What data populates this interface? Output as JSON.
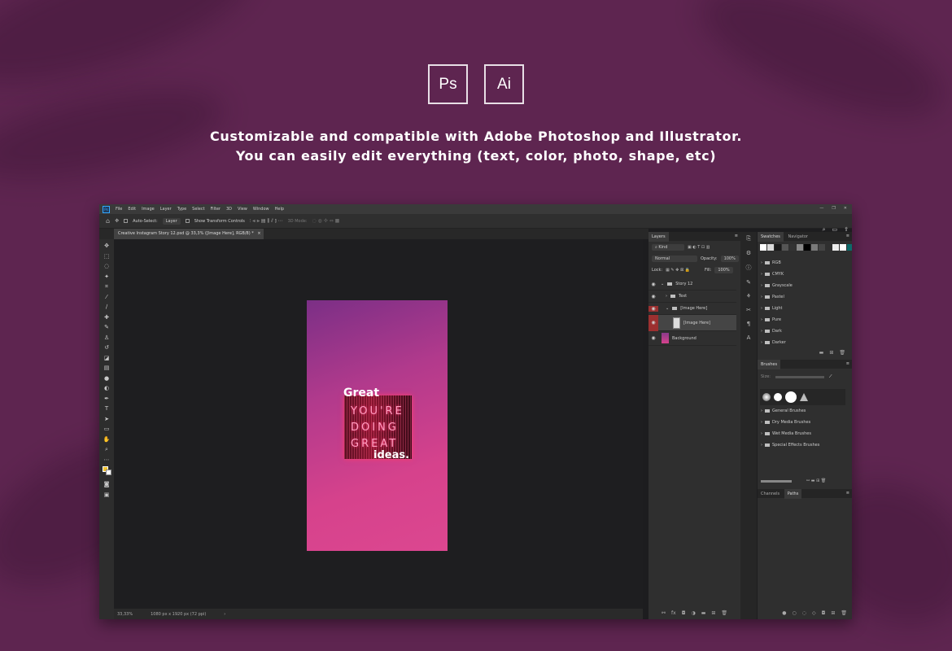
{
  "logos": {
    "ps": "Ps",
    "ai": "Ai"
  },
  "tagline": {
    "line1": "Customizable and compatible with Adobe Photoshop and Illustrator.",
    "line2": "You can easily edit everything (text, color, photo, shape, etc)"
  },
  "menu": [
    "File",
    "Edit",
    "Image",
    "Layer",
    "Type",
    "Select",
    "Filter",
    "3D",
    "View",
    "Window",
    "Help"
  ],
  "options": {
    "auto_select": "Auto-Select:",
    "layer_dropdown": "Layer",
    "transform": "Show Transform Controls",
    "mode3d": "3D Mode:"
  },
  "doc_tab": "Creative Instagram Story 12.psd @ 33,3% ([Image Here], RGB/8) *",
  "status": {
    "zoom": "33,33%",
    "size": "1080 px x 1920 px (72 ppi)"
  },
  "artwork": {
    "great": "Great",
    "ideas": "ideas.",
    "neon": [
      "YOU'RE",
      "DOING",
      "GREAT"
    ]
  },
  "layers_panel": {
    "tab": "Layers",
    "kind": "Kind",
    "blend": "Normal",
    "opacity_label": "Opacity:",
    "opacity": "100%",
    "lock_label": "Lock:",
    "fill_label": "Fill:",
    "fill": "100%",
    "layers": [
      {
        "name": "Story 12",
        "type": "group"
      },
      {
        "name": "Text",
        "type": "group"
      },
      {
        "name": "[Image Here]",
        "type": "group"
      },
      {
        "name": "[Image Here]",
        "type": "smart"
      },
      {
        "name": "Background",
        "type": "layer"
      }
    ]
  },
  "swatches_panel": {
    "tabs": [
      "Swatches",
      "Navigator"
    ],
    "groups": [
      "RGB",
      "CMYK",
      "Grayscale",
      "Pastel",
      "Light",
      "Pure",
      "Dark",
      "Darker"
    ],
    "recent_colors": [
      "#ffffff",
      "#d9d9d9",
      "#888888",
      "#555555",
      "#333333",
      "#1a1a1a",
      "#000000",
      "#7a7a7a",
      "#444444",
      "#eeeeee",
      "#ffffff",
      "#0c6b6b"
    ]
  },
  "brushes_panel": {
    "tab": "Brushes",
    "size_label": "Size:",
    "groups": [
      "General Brushes",
      "Dry Media Brushes",
      "Wet Media Brushes",
      "Special Effects Brushes"
    ]
  },
  "bottom_panel": {
    "tabs": [
      "Channels",
      "Paths"
    ]
  },
  "colors": {
    "page_bg": "#5e2550",
    "ps_blue": "#31a8ff",
    "fg_swatch": "#f2c32e",
    "bg_swatch": "#ffffff"
  }
}
